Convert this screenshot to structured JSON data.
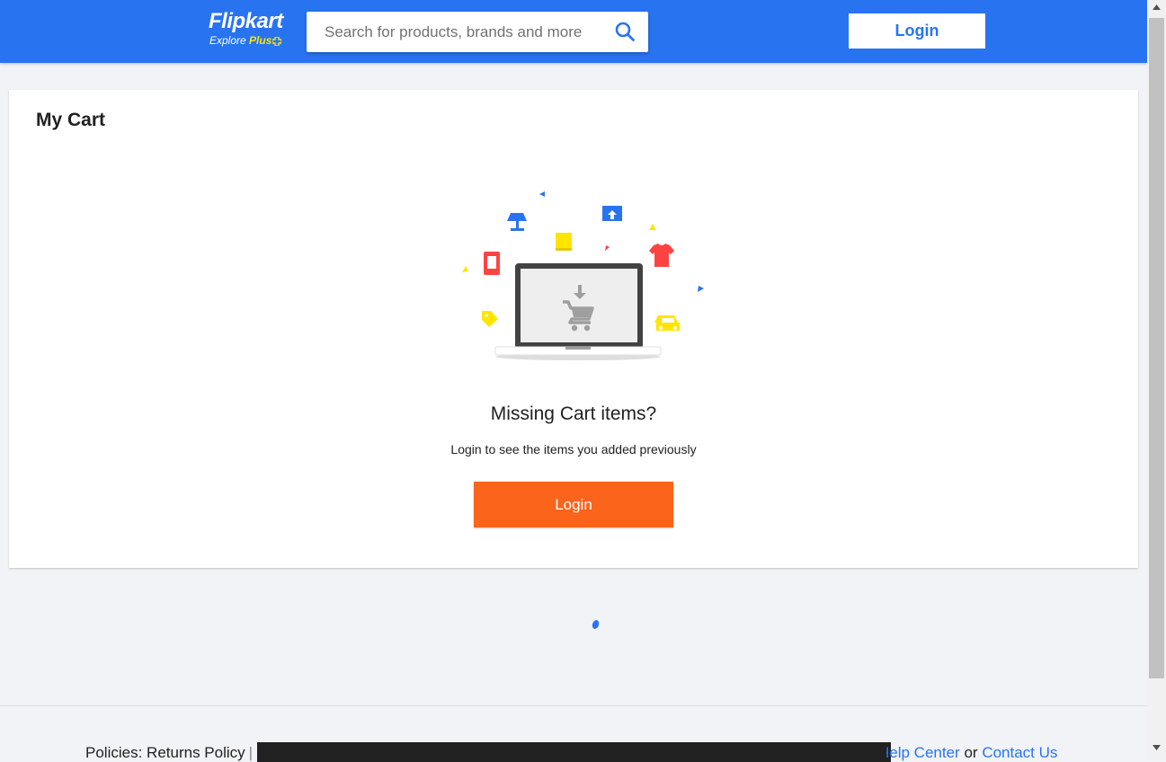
{
  "header": {
    "logo": {
      "brand": "Flipkart",
      "tagline_prefix": "Explore",
      "tagline_plus": "Plus"
    },
    "search": {
      "placeholder": "Search for products, brands and more",
      "value": ""
    },
    "login_label": "Login",
    "colors": {
      "background": "#2874f0",
      "plus_yellow": "#ffe500"
    }
  },
  "cart": {
    "title": "My Cart",
    "empty_heading": "Missing Cart items?",
    "empty_message": "Login to see the items you added previously",
    "login_label": "Login",
    "colors": {
      "cta": "#fb641b"
    }
  },
  "footer": {
    "policies_label": "Policies:",
    "returns_policy": "Returns Policy",
    "separator": "|",
    "help_center": "Help Center",
    "or": "or",
    "contact_us": "Contact Us"
  }
}
